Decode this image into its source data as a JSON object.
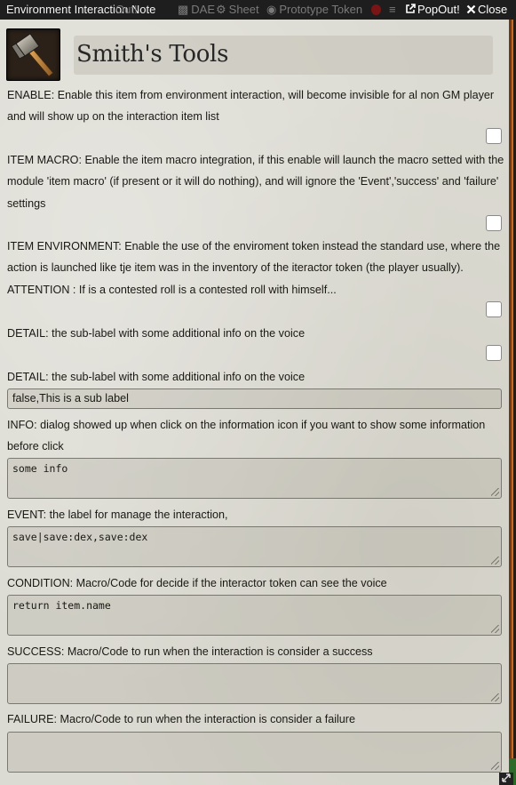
{
  "window": {
    "title": "Environment Interaction Note",
    "popout_label": "PopOut!",
    "close_label": "Close",
    "background_tabs": [
      {
        "label": "Out!",
        "icon": "popout-icon"
      },
      {
        "label": "DAE",
        "icon": "file-icon"
      },
      {
        "label": "Sheet",
        "icon": "gear-icon"
      },
      {
        "label": "Prototype Token",
        "icon": "user-icon"
      }
    ]
  },
  "item": {
    "name": "Smith's Tools",
    "image_icon": "hammer-icon"
  },
  "fields": {
    "enable": {
      "label": "ENABLE: Enable this item from environment interaction, will become invisible for al non GM player and will show up on the interaction item list",
      "checked": false
    },
    "item_macro": {
      "label": "ITEM MACRO: Enable the item macro integration, if this enable will launch the macro setted with the module 'item macro' (if present or it will do nothing), and will ignore the 'Event','success' and 'failure' settings",
      "checked": false
    },
    "item_environment": {
      "label": "ITEM ENVIRONMENT: Enable the use of the enviroment token instead the standard use, where the action is launched like tje item was in the inventory of the iteractor token (the player usually). ATTENTION : If is a contested roll is a contested roll with himself...",
      "checked": false
    },
    "detail_check": {
      "label": "DETAIL: the sub-label with some additional info on the voice",
      "checked": false
    },
    "detail_text": {
      "label": "DETAIL: the sub-label with some additional info on the voice",
      "value": "false,This is a sub label"
    },
    "info": {
      "label": "INFO: dialog showed up when click on the information icon if you want to show some information before click",
      "value": "some info"
    },
    "event": {
      "label": "EVENT: the label for manage the interaction,",
      "value": "save|save:dex,save:dex"
    },
    "condition": {
      "label": "CONDITION: Macro/Code for decide if the interactor token can see the voice",
      "value": "return item.name"
    },
    "success": {
      "label": "SUCCESS: Macro/Code to run when the interaction is consider a success",
      "value": ""
    },
    "failure": {
      "label": "FAILURE: Macro/Code to run when the interaction is consider a failure",
      "value": ""
    }
  }
}
